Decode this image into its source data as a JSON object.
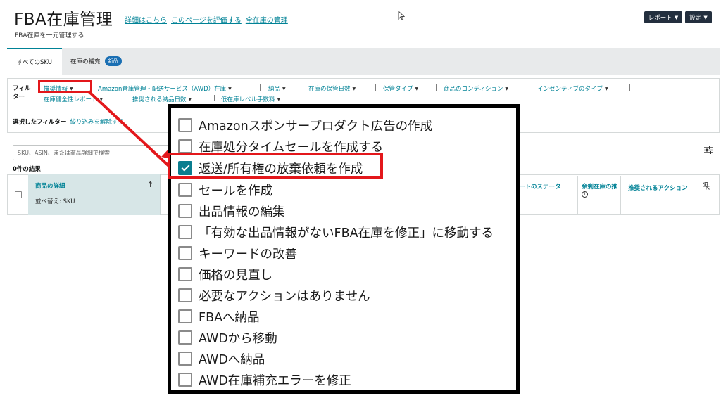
{
  "header": {
    "title": "FBA在庫管理",
    "links": [
      "詳細はこちら",
      "このページを評価する",
      "全在庫の管理"
    ],
    "subtitle": "FBA在庫を一元管理する",
    "report_button": "レポート",
    "settings_button": "設定"
  },
  "tabs": {
    "all_sku": "すべてのSKU",
    "replenish": "在庫の補充",
    "new_badge": "新品"
  },
  "filters": {
    "label_line1": "フィル",
    "label_line2": "ター",
    "items": [
      "推奨情報",
      "Amazon倉庫管理・配送サービス（AWD）在庫",
      "納品",
      "在庫の保管日数",
      "保管タイプ",
      "商品のコンディション",
      "インセンティブのタイプ",
      "在庫健全性レポート",
      "推奨される納品日数",
      "低在庫レベル手数料"
    ],
    "selected_label": "選択したフィルター",
    "refine_link": "絞り込みを解除する"
  },
  "search": {
    "placeholder": "SKU、ASIN、または商品詳細で検索"
  },
  "results": "0件の結果",
  "table": {
    "product_details": "商品の詳細",
    "sort_label": "並べ替え: SKU",
    "status_col": "ートのステータ",
    "surplus_col": "余剰在庫の推",
    "action_col": "推奨されるアクション"
  },
  "dropdown": {
    "options": [
      {
        "label": "Amazonスポンサープロダクト広告の作成",
        "checked": false
      },
      {
        "label": "在庫処分タイムセールを作成する",
        "checked": false
      },
      {
        "label": "返送/所有権の放棄依頼を作成",
        "checked": true
      },
      {
        "label": "セールを作成",
        "checked": false
      },
      {
        "label": "出品情報の編集",
        "checked": false
      },
      {
        "label": "「有効な出品情報がないFBA在庫を修正」に移動する",
        "checked": false
      },
      {
        "label": "キーワードの改善",
        "checked": false
      },
      {
        "label": "価格の見直し",
        "checked": false
      },
      {
        "label": "必要なアクションはありません",
        "checked": false
      },
      {
        "label": "FBAへ納品",
        "checked": false
      },
      {
        "label": "AWDから移動",
        "checked": false
      },
      {
        "label": "AWDへ納品",
        "checked": false
      },
      {
        "label": "AWD在庫補充エラーを修正",
        "checked": false
      }
    ]
  },
  "icons": {
    "report_chevron": "chevron-down-icon",
    "settings_chevron": "chevron-down-icon",
    "sort_arrow": "arrow-up-icon",
    "info": "info-icon",
    "pin": "pin-icon",
    "column_settings": "sliders-icon",
    "cursor": "mouse-cursor-icon"
  },
  "colors": {
    "link": "#008296",
    "highlight_red": "#e3171b",
    "checked": "#0a7d8f",
    "header_button": "#232f3e"
  }
}
